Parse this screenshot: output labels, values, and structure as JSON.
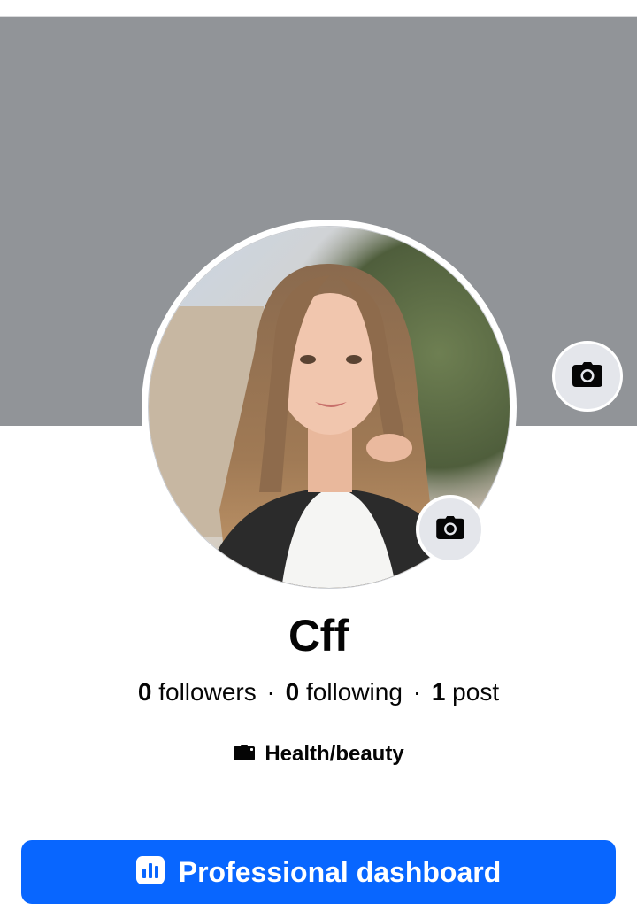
{
  "profile": {
    "name": "Cff",
    "stats": {
      "followers_count": "0",
      "followers_label": "followers",
      "following_count": "0",
      "following_label": "following",
      "posts_count": "1",
      "posts_label": "post",
      "separator": "·"
    },
    "category": {
      "icon": "briefcase-icon",
      "label": "Health/beauty"
    }
  },
  "cover": {
    "color": "#919498",
    "camera_icon": "camera-icon"
  },
  "avatar": {
    "camera_icon": "camera-icon"
  },
  "actions": {
    "dashboard_label": "Professional dashboard",
    "dashboard_icon": "bar-chart-icon"
  },
  "colors": {
    "accent": "#0866ff",
    "icon_bg": "#e4e6eb"
  }
}
